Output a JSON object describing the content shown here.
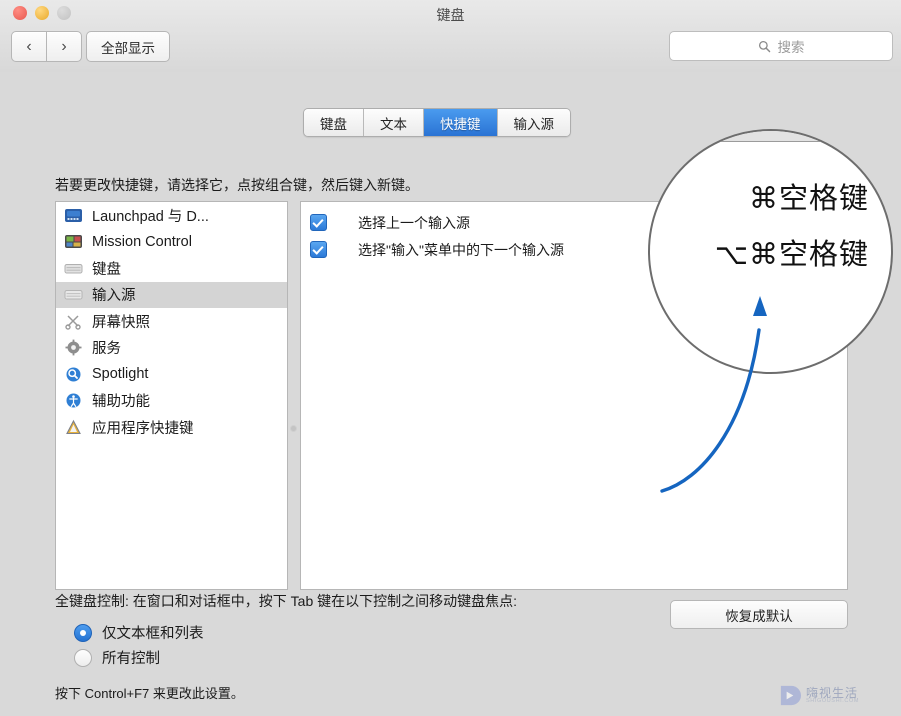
{
  "window": {
    "title": "键盘",
    "traffic_lights": [
      "close-red",
      "minimize-yellow",
      "zoom-gray"
    ],
    "nav_back": "‹",
    "nav_forward": "›",
    "show_all_label": "全部显示"
  },
  "search": {
    "placeholder": "搜索",
    "icon": "search-icon"
  },
  "tabs": [
    {
      "label": "键盘",
      "active": false
    },
    {
      "label": "文本",
      "active": false
    },
    {
      "label": "快捷键",
      "active": true
    },
    {
      "label": "输入源",
      "active": false
    }
  ],
  "instruction": "若要更改快捷键，请选择它，点按组合键，然后键入新键。",
  "categories": [
    {
      "label": "Launchpad 与 D...",
      "icon": "launchpad-icon",
      "selected": false
    },
    {
      "label": "Mission Control",
      "icon": "mission-control-icon",
      "selected": false
    },
    {
      "label": "键盘",
      "icon": "keyboard-icon",
      "selected": false
    },
    {
      "label": "输入源",
      "icon": "input-source-icon",
      "selected": true
    },
    {
      "label": "屏幕快照",
      "icon": "screenshot-scissors-icon",
      "selected": false
    },
    {
      "label": "服务",
      "icon": "gear-icon",
      "selected": false
    },
    {
      "label": "Spotlight",
      "icon": "spotlight-magnifier-icon",
      "selected": false
    },
    {
      "label": "辅助功能",
      "icon": "accessibility-icon",
      "selected": false
    },
    {
      "label": "应用程序快捷键",
      "icon": "app-shortcuts-icon",
      "selected": false
    }
  ],
  "shortcuts": [
    {
      "label": "选择上一个输入源",
      "checked": true,
      "keys": ""
    },
    {
      "label": "选择\"输入\"菜单中的下一个输入源",
      "checked": true,
      "keys": ""
    }
  ],
  "magnifier": {
    "line1": "⌘空格键",
    "line2": "⌥⌘空格键",
    "arrow": "blue-curved-arrow"
  },
  "restore_button": "恢复成默认",
  "full_keyboard": {
    "label": "全键盘控制: 在窗口和对话框中，按下 Tab 键在以下控制之间移动键盘焦点:",
    "options": [
      {
        "label": "仅文本框和列表",
        "selected": true
      },
      {
        "label": "所有控制",
        "selected": false
      }
    ],
    "hint": "按下 Control+F7 来更改此设置。"
  },
  "watermark": {
    "cn": "嗨视生活",
    "en": "SHIGOUSHI.COM"
  },
  "colors": {
    "accent_blue": "#2a73d4",
    "checkbox_blue": "#2b79d8",
    "arrow_blue": "#1565c0",
    "window_bg": "#d9d9d9",
    "panel_bg": "#ffffff",
    "selected_row": "#d4d4d4"
  }
}
